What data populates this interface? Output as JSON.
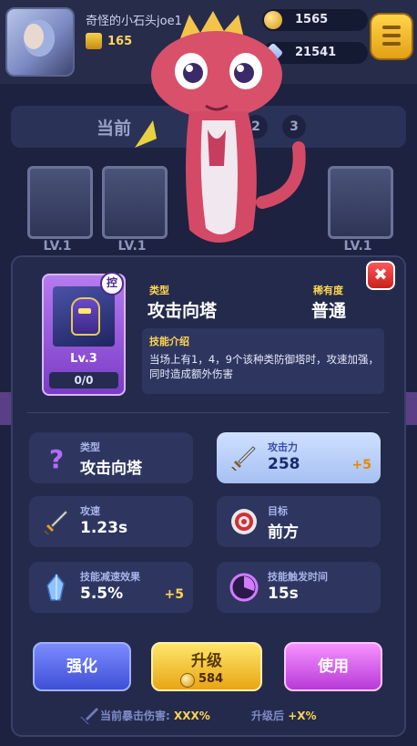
{
  "header": {
    "username": "奇怪的小石头joe1",
    "trophies": "165",
    "gold": "1565",
    "gems": "21541"
  },
  "background": {
    "section_label": "当前",
    "tab_numbers": [
      "2",
      "3"
    ],
    "card_levels": [
      "LV.1",
      "LV.1",
      "LV.1"
    ]
  },
  "card": {
    "badge": "控",
    "level": "Lv.3",
    "progress": "0/0"
  },
  "info": {
    "type_label": "类型",
    "type_value": "攻击向塔",
    "rarity_label": "稀有度",
    "rarity_value": "普通",
    "skill_title": "技能介绍",
    "skill_text": "当场上有1，4，9个该种类防御塔时，攻速加强，同时造成额外伤害"
  },
  "stats": [
    {
      "label": "类型",
      "value": "攻击向塔",
      "plus": "",
      "icon": "question-icon"
    },
    {
      "label": "攻击力",
      "value": "258",
      "plus": "+5",
      "icon": "sword-icon",
      "highlight": true
    },
    {
      "label": "攻速",
      "value": "1.23s",
      "plus": "",
      "icon": "sword-icon"
    },
    {
      "label": "目标",
      "value": "前方",
      "plus": "",
      "icon": "target-icon"
    },
    {
      "label": "技能减速效果",
      "value": "5.5%",
      "plus": "+5",
      "icon": "crystal-icon"
    },
    {
      "label": "技能触发时间",
      "value": "15s",
      "plus": "",
      "icon": "clock-icon"
    }
  ],
  "buttons": {
    "strengthen": "强化",
    "upgrade": "升级",
    "upgrade_cost": "584",
    "use": "使用"
  },
  "footer": {
    "crit_label": "当前暴击伤害:",
    "crit_value": "XXX%",
    "after_label": "升级后",
    "after_value": "+X%"
  },
  "colors": {
    "accent_yellow": "#ffd451",
    "panel": "#232a4b",
    "highlight_stat": "#cfe0ff",
    "close_red": "#e02a26"
  }
}
